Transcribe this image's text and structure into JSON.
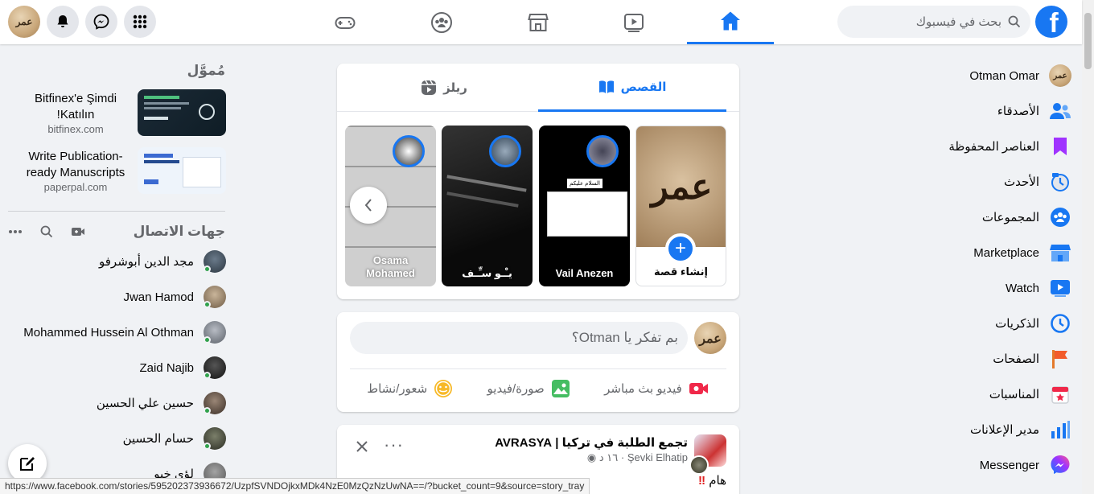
{
  "topbar": {
    "search_placeholder": "بحث في فيسبوك",
    "logo_letter": "f",
    "profile_initials": "عمر",
    "nav_tabs": [
      "home-icon",
      "watch-icon",
      "marketplace-icon",
      "groups-icon",
      "gaming-icon"
    ]
  },
  "rightnav": {
    "items": [
      {
        "label": "Otman Omar",
        "icon": "profile-avatar"
      },
      {
        "label": "الأصدقاء",
        "icon": "friends-icon"
      },
      {
        "label": "العناصر المحفوظة",
        "icon": "bookmark-icon"
      },
      {
        "label": "الأحدث",
        "icon": "feeds-icon"
      },
      {
        "label": "المجموعات",
        "icon": "groups-icon"
      },
      {
        "label": "Marketplace",
        "icon": "marketplace-icon"
      },
      {
        "label": "Watch",
        "icon": "watch-icon"
      },
      {
        "label": "الذكريات",
        "icon": "memories-icon"
      },
      {
        "label": "الصفحات",
        "icon": "pages-flag-icon"
      },
      {
        "label": "المناسبات",
        "icon": "events-icon"
      },
      {
        "label": "مدير الإعلانات",
        "icon": "ads-manager-icon"
      },
      {
        "label": "Messenger",
        "icon": "messenger-icon"
      }
    ]
  },
  "leftcol": {
    "sponsored_heading": "مُموَّل",
    "ads": [
      {
        "title": "Bitfinex'e Şimdi Katılın!",
        "site": "bitfinex.com"
      },
      {
        "title": "Write Publication-ready Manuscripts",
        "site": "paperpal.com"
      }
    ],
    "contacts_heading": "جهات الاتصال",
    "contacts": [
      {
        "name": "مجد الدين أبوشرفو"
      },
      {
        "name": "Jwan Hamod"
      },
      {
        "name": "Mohammed Hussein Al Othman"
      },
      {
        "name": "Zaid Najib"
      },
      {
        "name": "حسين علي الحسين"
      },
      {
        "name": "حسام الحسين"
      },
      {
        "name": "لؤي خيو"
      }
    ]
  },
  "stories": {
    "tab_stories": "القصص",
    "tab_reels": "ريلز",
    "create_label": "إنشاء قصة",
    "items": [
      {
        "name": "Vail Anezen",
        "text": "السلام عليكم"
      },
      {
        "name": "يـْـو سـِّـف"
      },
      {
        "name": "Osama Mohamed"
      }
    ]
  },
  "composer": {
    "placeholder": "بم تفكر يا Otman؟",
    "actions": [
      {
        "label": "فيديو بث مباشر",
        "icon": "live-video-icon",
        "color": "#f02849"
      },
      {
        "label": "صورة/فيديو",
        "icon": "photo-icon",
        "color": "#45bd62"
      },
      {
        "label": "شعور/نشاط",
        "icon": "feeling-icon",
        "color": "#f7b928"
      }
    ]
  },
  "post": {
    "title": "تجمع الطلبة في تركيا | AVRASYA",
    "author": "Şevki Elhatip",
    "time": "١٦ د",
    "body": "هام"
  },
  "statusbar": {
    "url": "https://www.facebook.com/stories/595202373936672/UzpfSVNDOjkxMDk4NzE0MzQzNzUwNA==/?bucket_count=9&source=story_tray"
  },
  "colors": {
    "accent": "#1877f2",
    "online": "#31a24c"
  }
}
